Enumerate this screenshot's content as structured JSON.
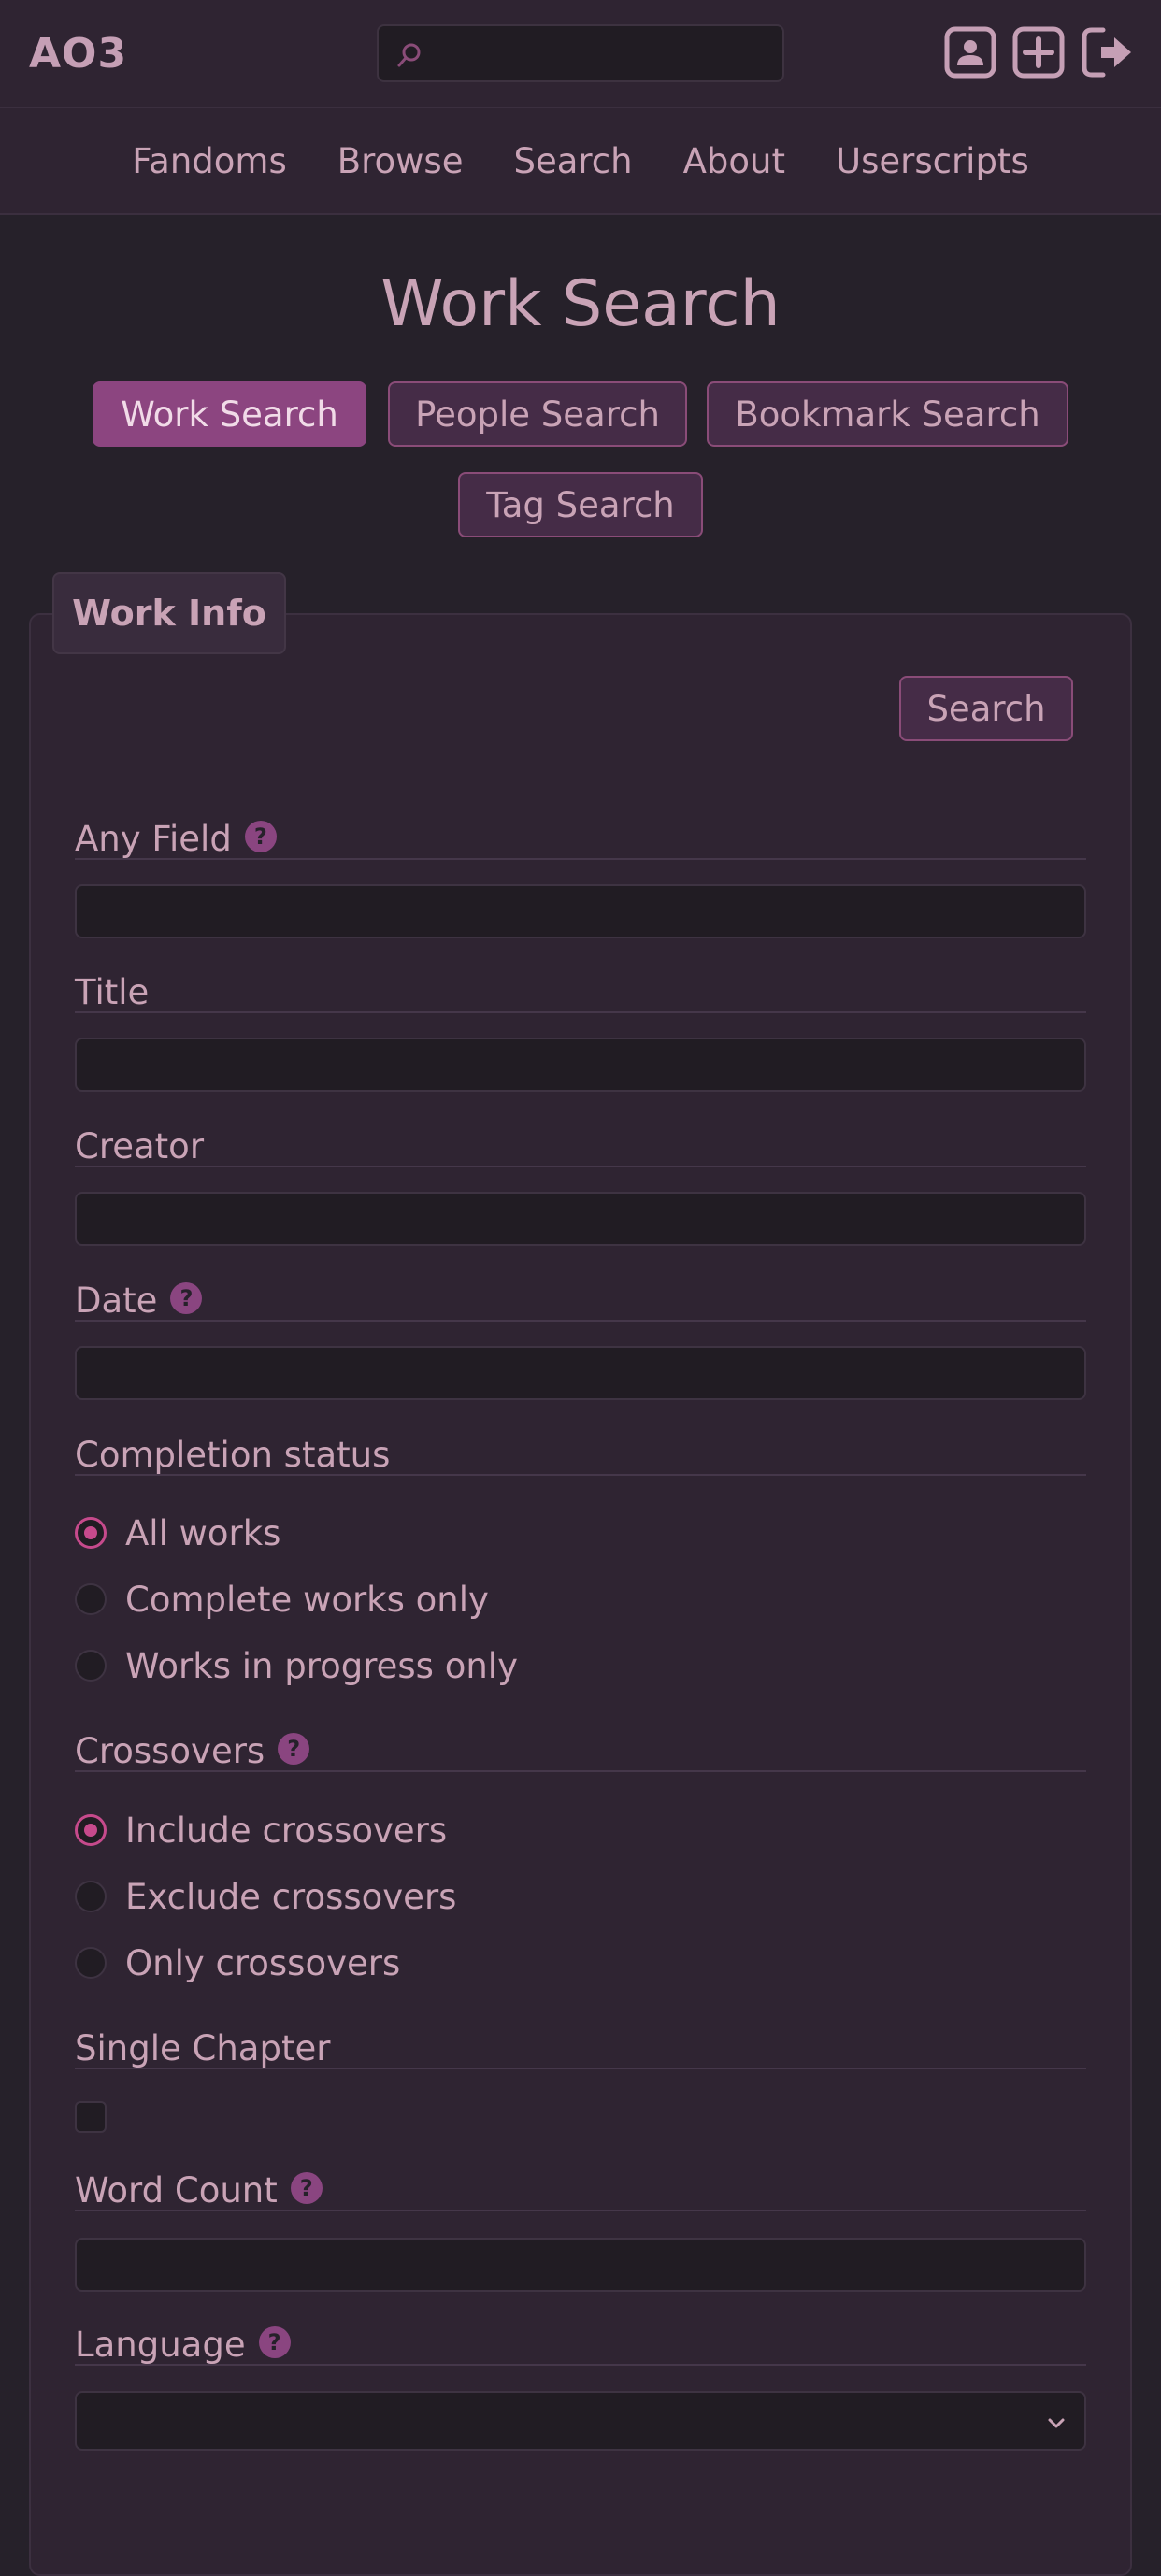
{
  "header": {
    "logo": "AO3",
    "search": {
      "value": "",
      "placeholder": ""
    },
    "icons": [
      "user-icon",
      "add-icon",
      "logout-icon"
    ]
  },
  "nav": {
    "items": [
      "Fandoms",
      "Browse",
      "Search",
      "About",
      "Userscripts"
    ]
  },
  "page": {
    "title": "Work Search",
    "tabs": [
      {
        "label": "Work Search",
        "active": true
      },
      {
        "label": "People Search",
        "active": false
      },
      {
        "label": "Bookmark Search",
        "active": false
      },
      {
        "label": "Tag Search",
        "active": false
      }
    ]
  },
  "form": {
    "legend": "Work Info",
    "search_button": "Search",
    "any_field": {
      "label": "Any Field",
      "value": ""
    },
    "title": {
      "label": "Title",
      "value": ""
    },
    "creator": {
      "label": "Creator",
      "value": ""
    },
    "date": {
      "label": "Date",
      "value": ""
    },
    "completion": {
      "label": "Completion status",
      "options": [
        "All works",
        "Complete works only",
        "Works in progress only"
      ],
      "selected": "All works"
    },
    "crossovers": {
      "label": "Crossovers",
      "options": [
        "Include crossovers",
        "Exclude crossovers",
        "Only crossovers"
      ],
      "selected": "Include crossovers"
    },
    "single_chapter": {
      "label": "Single Chapter",
      "checked": false
    },
    "word_count": {
      "label": "Word Count",
      "value": ""
    },
    "language": {
      "label": "Language",
      "value": ""
    },
    "help_glyph": "?"
  },
  "colors": {
    "background": "#26212a",
    "panel": "#2f2432",
    "accent": "#8c4580",
    "radio_accent": "#c64a8c",
    "text": "#c9a3b6"
  }
}
